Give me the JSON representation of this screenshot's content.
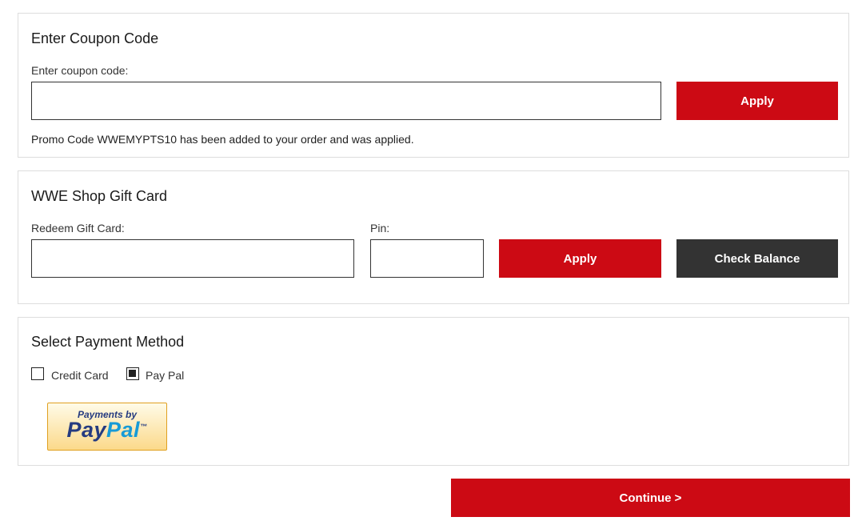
{
  "coupon": {
    "title": "Enter Coupon Code",
    "field_label": "Enter coupon code:",
    "field_value": "",
    "apply_label": "Apply",
    "message": "Promo Code WWEMYPTS10 has been added to your order and was applied."
  },
  "gift_card": {
    "title": "WWE Shop Gift Card",
    "redeem_label": "Redeem Gift Card:",
    "redeem_value": "",
    "pin_label": "Pin:",
    "pin_value": "",
    "apply_label": "Apply",
    "check_balance_label": "Check Balance"
  },
  "payment": {
    "title": "Select Payment Method",
    "options": [
      {
        "label": "Credit Card",
        "checked": false
      },
      {
        "label": "Pay Pal",
        "checked": true
      }
    ],
    "paypal_logo": {
      "line1": "Payments by",
      "line2_a": "Pay",
      "line2_b": "Pal",
      "mark": "™"
    }
  },
  "continue_label": "Continue >",
  "colors": {
    "primary": "#cc0a14",
    "secondary": "#333333",
    "paypal_blue": "#253b80",
    "paypal_light_blue": "#179bd7"
  }
}
